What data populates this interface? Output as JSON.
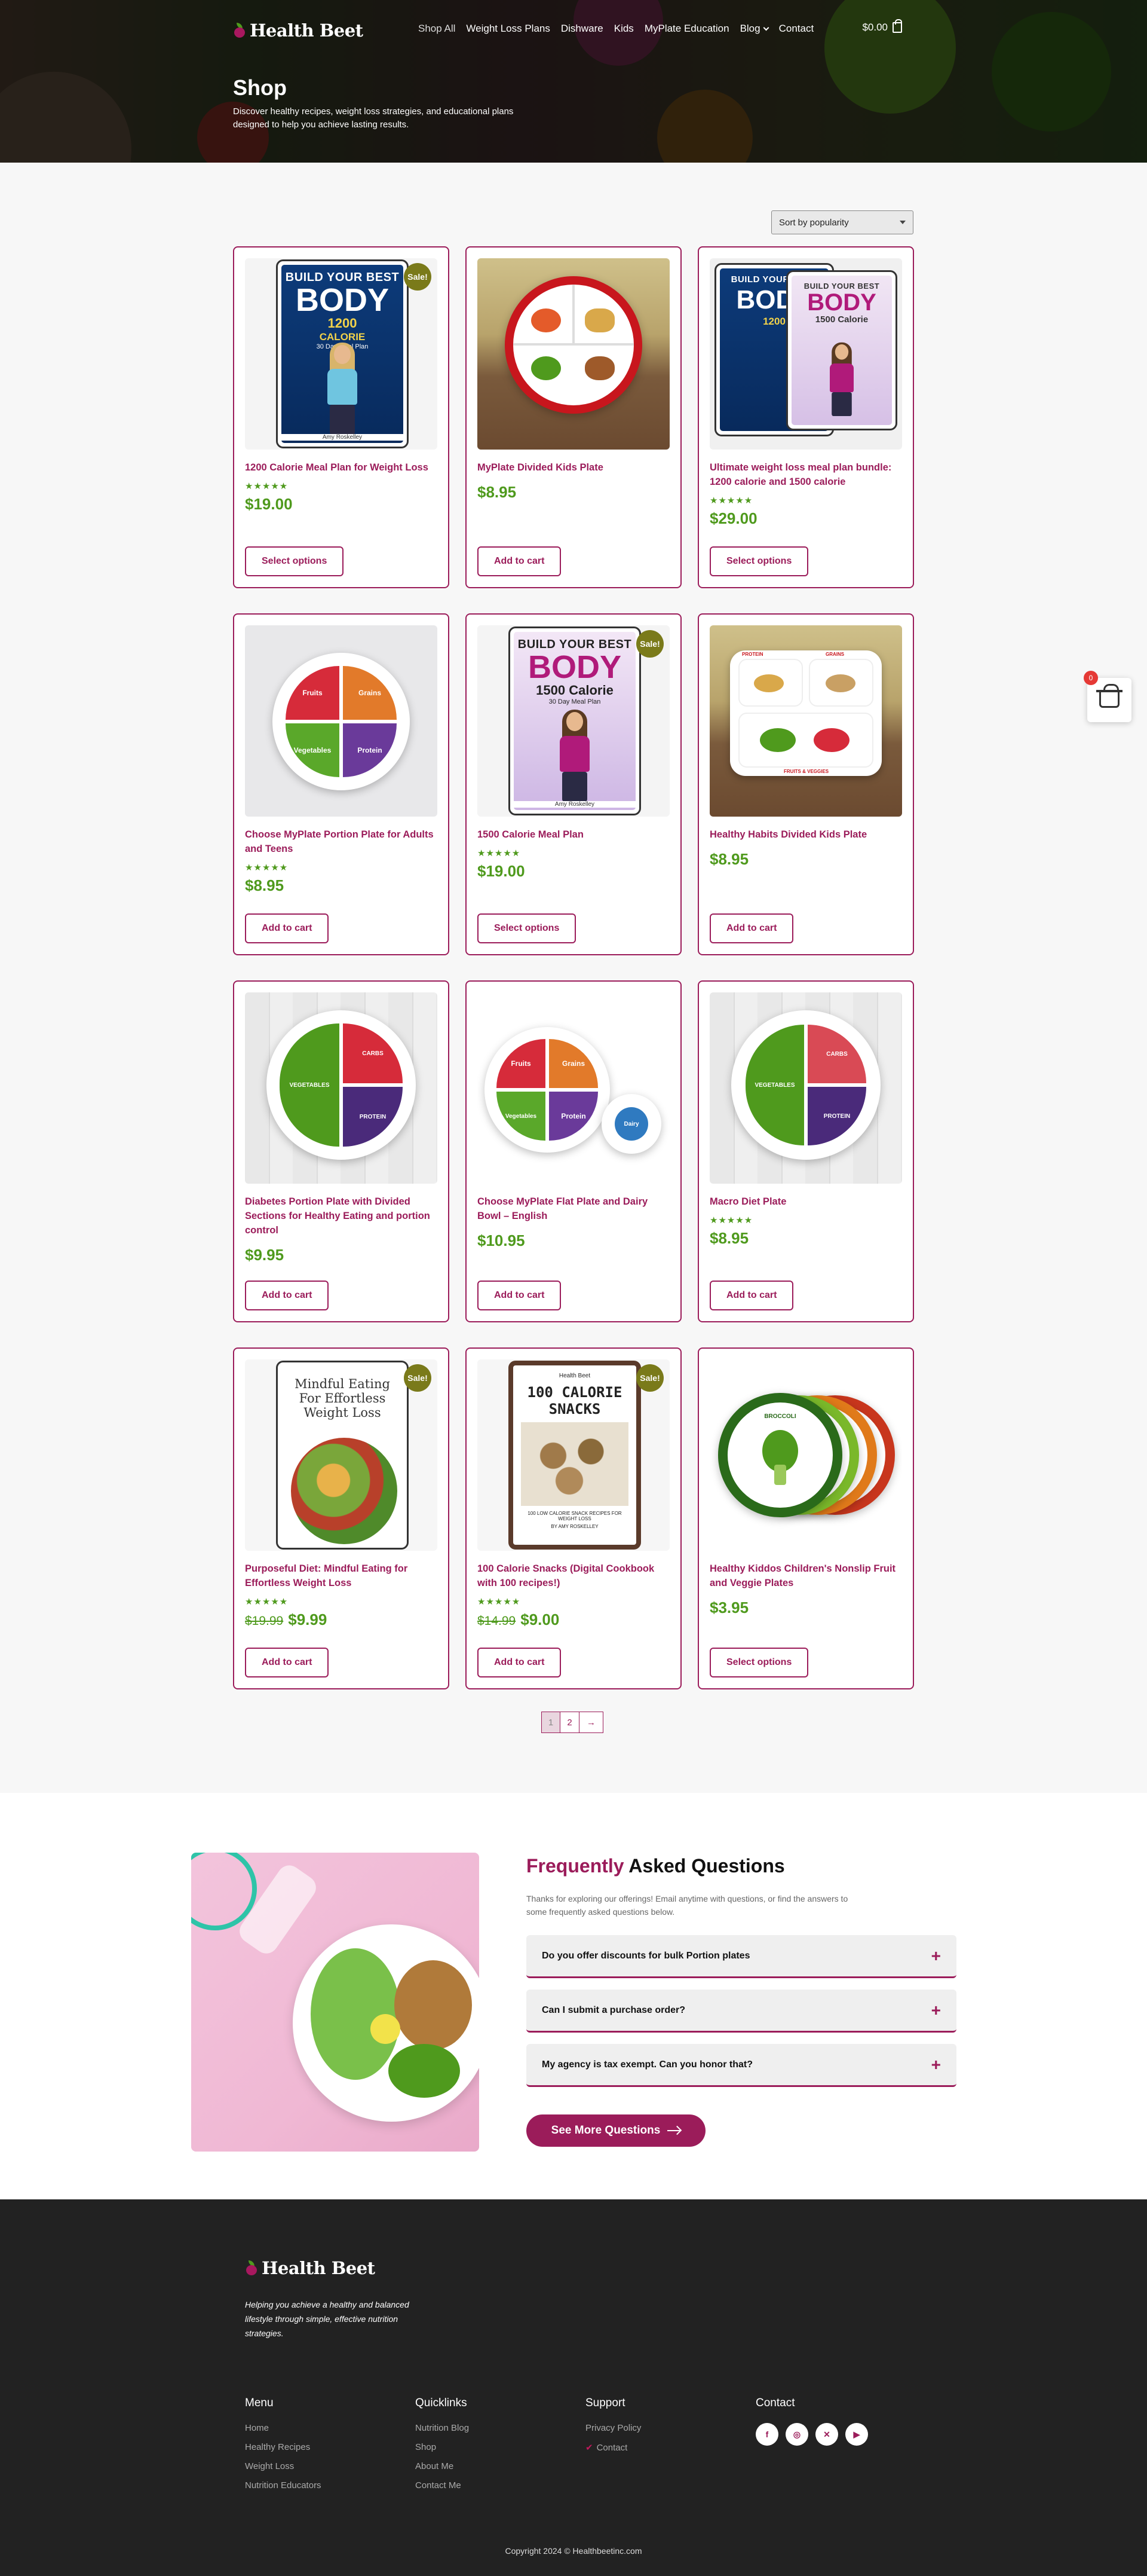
{
  "header": {
    "logo": "Health Beet",
    "nav": [
      {
        "label": "Shop All",
        "active": true
      },
      {
        "label": "Weight Loss Plans"
      },
      {
        "label": "Dishware"
      },
      {
        "label": "Kids"
      },
      {
        "label": "MyPlate Education"
      },
      {
        "label": "Blog"
      },
      {
        "label": "Contact"
      }
    ],
    "cart_total": "$0.00",
    "page_title": "Shop",
    "page_subtitle": "Discover healthy recipes, weight loss strategies, and educational plans designed to help you achieve lasting results."
  },
  "shop": {
    "sort_label": "Sort by popularity",
    "products": [
      {
        "name": "1200 Calorie Meal Plan for Weight Loss",
        "stars": "★★★★★",
        "price": "$19.00",
        "old_price": "",
        "button": "Select options",
        "sale": true,
        "img": "book-1200"
      },
      {
        "name": "MyPlate Divided Kids Plate",
        "stars": "",
        "price": "$8.95",
        "old_price": "",
        "button": "Add to cart",
        "sale": false,
        "img": "kids-plate"
      },
      {
        "name": "Ultimate weight loss meal plan bundle: 1200 calorie and 1500 calorie",
        "stars": "★★★★★",
        "price": "$29.00",
        "old_price": "",
        "button": "Select options",
        "sale": false,
        "img": "bundle"
      },
      {
        "name": "Choose MyPlate Portion Plate for Adults and Teens",
        "stars": "★★★★★",
        "price": "$8.95",
        "old_price": "",
        "button": "Add to cart",
        "sale": false,
        "img": "myplate"
      },
      {
        "name": "1500 Calorie Meal Plan",
        "stars": "★★★★★",
        "price": "$19.00",
        "old_price": "",
        "button": "Select options",
        "sale": true,
        "img": "book-1500"
      },
      {
        "name": "Healthy Habits Divided Kids Plate",
        "stars": "",
        "price": "$8.95",
        "old_price": "",
        "button": "Add to cart",
        "sale": false,
        "img": "habits"
      },
      {
        "name": "Diabetes Portion Plate with Divided Sections for Healthy Eating and portion control",
        "stars": "",
        "price": "$9.95",
        "old_price": "",
        "button": "Add to cart",
        "sale": false,
        "img": "diabetes"
      },
      {
        "name": "Choose MyPlate Flat Plate and Dairy Bowl – English",
        "stars": "",
        "price": "$10.95",
        "old_price": "",
        "button": "Add to cart",
        "sale": false,
        "img": "flat"
      },
      {
        "name": "Macro Diet Plate",
        "stars": "★★★★★",
        "price": "$8.95",
        "old_price": "",
        "button": "Add to cart",
        "sale": false,
        "img": "macro"
      },
      {
        "name": "Purposeful Diet: Mindful Eating for Effortless Weight Loss",
        "stars": "★★★★★",
        "price": "$9.99",
        "old_price": "$19.99",
        "button": "Add to cart",
        "sale": true,
        "img": "mindful"
      },
      {
        "name": "100 Calorie Snacks (Digital Cookbook with 100 recipes!)",
        "stars": "★★★★★",
        "price": "$9.00",
        "old_price": "$14.99",
        "button": "Add to cart",
        "sale": true,
        "img": "snacks"
      },
      {
        "name": "Healthy Kiddos Children's Nonslip Fruit and Veggie Plates",
        "stars": "",
        "price": "$3.95",
        "old_price": "",
        "button": "Select options",
        "sale": false,
        "img": "kiddos"
      }
    ],
    "sale_label": "Sale!",
    "pagination": [
      "1",
      "2",
      "→"
    ],
    "book_1200": {
      "t1": "BUILD YOUR BEST",
      "t2": "BODY",
      "t3": "1200",
      "t3b": "CALORIE",
      "t4": "30 Day Meal Plan",
      "author": "Amy Roskelley"
    },
    "book_1500": {
      "t1": "BUILD YOUR BEST",
      "t2": "BODY",
      "t3": "1500 Calorie",
      "t4": "30 Day Meal Plan",
      "author": "Amy Roskelley"
    },
    "mindful": {
      "t1": "Mindful Eating",
      "t2": "For Effortless",
      "t3": "Weight Loss"
    },
    "snacks": {
      "brand": "Health Beet",
      "t1": "100 CALORIE",
      "t2": "SNACKS",
      "t3": "100 LOW CALORIE SNACK RECIPES FOR WEIGHT LOSS",
      "t4": "BY AMY ROSKELLEY"
    },
    "plate_labels": {
      "fruits": "Fruits",
      "grains": "Grains",
      "vegetables": "Vegetables",
      "protein": "Protein",
      "dairy": "Dairy"
    },
    "macro_labels": {
      "vegetables": "VEGETABLES",
      "carbs": "CARBS",
      "protein": "PROTEIN"
    },
    "kids_plate_labels": {
      "fruits": "FRUITS",
      "grains": "GRAINS",
      "vegetables": "VEGETABLES",
      "protein": "PROTEIN",
      "dairy": "DAIRY"
    },
    "habits_labels": {
      "protein": "PROTEIN",
      "grains": "GRAINS",
      "fruits": "FRUITS & VEGGIES"
    },
    "kiddos_label": "BROCCOLI"
  },
  "faq": {
    "title_highlight": "Frequently",
    "title_rest": "Asked Questions",
    "intro": "Thanks for exploring our offerings! Email anytime with questions, or find the answers to some frequently asked questions below.",
    "questions": [
      "Do you offer discounts for bulk Portion plates",
      "Can I submit a purchase order?",
      "My agency is tax exempt. Can you honor that?"
    ],
    "button": "See More Questions"
  },
  "footer": {
    "logo": "Health Beet",
    "tagline": "Helping you achieve a healthy and balanced lifestyle through simple, effective nutrition strategies.",
    "columns": [
      {
        "title": "Menu",
        "links": [
          "Home",
          "Healthy Recipes",
          "Weight Loss",
          "Nutrition Educators"
        ]
      },
      {
        "title": "Quicklinks",
        "links": [
          "Nutrition Blog",
          "Shop",
          "About Me",
          "Contact Me"
        ]
      },
      {
        "title": "Support",
        "links": [
          "Privacy Policy",
          "Contact"
        ]
      },
      {
        "title": "Contact",
        "links": []
      }
    ],
    "social": [
      "facebook-icon",
      "instagram-icon",
      "x-icon",
      "youtube-icon"
    ],
    "copyright": "Copyright 2024 © Healthbeetinc.com"
  },
  "floating_cart": {
    "count": "0"
  },
  "colors": {
    "brand": "#9b1c5a",
    "price_green": "#4f9a1d",
    "footer_bg": "#222222"
  }
}
